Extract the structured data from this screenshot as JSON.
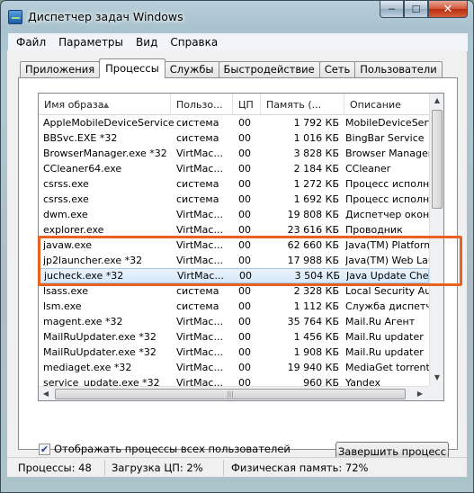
{
  "window": {
    "title": "Диспетчер задач Windows"
  },
  "menu": [
    "Файл",
    "Параметры",
    "Вид",
    "Справка"
  ],
  "tabs": [
    "Приложения",
    "Процессы",
    "Службы",
    "Быстродействие",
    "Сеть",
    "Пользователи"
  ],
  "active_tab": "Процессы",
  "columns": [
    "Имя образа",
    "Пользо...",
    "ЦП",
    "Память (...",
    "Описание"
  ],
  "processes": [
    {
      "name": "AppleMobileDeviceService....",
      "user": "система",
      "cpu": "00",
      "mem": "1 792 КБ",
      "desc": "MobileDeviceService"
    },
    {
      "name": "BBSvc.EXE *32",
      "user": "система",
      "cpu": "00",
      "mem": "1 016 КБ",
      "desc": "BingBar Service"
    },
    {
      "name": "BrowserManager.exe *32",
      "user": "VirtMac...",
      "cpu": "00",
      "mem": "3 828 КБ",
      "desc": "Browser Manager"
    },
    {
      "name": "CCleaner64.exe",
      "user": "VirtMac...",
      "cpu": "00",
      "mem": "2 184 КБ",
      "desc": "CCleaner"
    },
    {
      "name": "csrss.exe",
      "user": "система",
      "cpu": "00",
      "mem": "1 272 КБ",
      "desc": "Процесс исполнения"
    },
    {
      "name": "csrss.exe",
      "user": "система",
      "cpu": "00",
      "mem": "1 692 КБ",
      "desc": "Процесс исполнения"
    },
    {
      "name": "dwm.exe",
      "user": "VirtMac...",
      "cpu": "00",
      "mem": "19 808 КБ",
      "desc": "Диспетчер окон рабо"
    },
    {
      "name": "explorer.exe",
      "user": "VirtMac...",
      "cpu": "00",
      "mem": "23 616 КБ",
      "desc": "Проводник"
    },
    {
      "name": "javaw.exe",
      "user": "VirtMac...",
      "cpu": "00",
      "mem": "62 660 КБ",
      "desc": "Java(TM) Platform SE"
    },
    {
      "name": "jp2launcher.exe *32",
      "user": "VirtMac...",
      "cpu": "00",
      "mem": "17 988 КБ",
      "desc": "Java(TM) Web Launch"
    },
    {
      "name": "jucheck.exe *32",
      "user": "VirtMac...",
      "cpu": "00",
      "mem": "3 504 КБ",
      "desc": "Java Update Checker"
    },
    {
      "name": "lsass.exe",
      "user": "система",
      "cpu": "00",
      "mem": "2 328 КБ",
      "desc": "Local Security Authori"
    },
    {
      "name": "lsm.exe",
      "user": "система",
      "cpu": "00",
      "mem": "1 112 КБ",
      "desc": "Служба диспетчера"
    },
    {
      "name": "magent.exe *32",
      "user": "VirtMac...",
      "cpu": "00",
      "mem": "35 764 КБ",
      "desc": "Mail.Ru Агент"
    },
    {
      "name": "MailRuUpdater.exe *32",
      "user": "VirtMac...",
      "cpu": "00",
      "mem": "1 456 КБ",
      "desc": "Mail.Ru updater"
    },
    {
      "name": "MailRuUpdater.exe *32",
      "user": "VirtMac...",
      "cpu": "00",
      "mem": "1 908 КБ",
      "desc": "Mail.Ru updater"
    },
    {
      "name": "mediaget.exe *32",
      "user": "VirtMac...",
      "cpu": "00",
      "mem": "19 940 КБ",
      "desc": "MediaGet torrent clien"
    },
    {
      "name": "service_update.exe *32",
      "user": "VirtMac...",
      "cpu": "00",
      "mem": "960 КБ",
      "desc": "Yandex"
    }
  ],
  "selected_process": "jucheck.exe *32",
  "show_all_label": "Отображать процессы всех пользователей",
  "show_all_checked": true,
  "end_process_label": "Завершить процесс",
  "status": {
    "processes": "Процессы: 48",
    "cpu": "Загрузка ЦП: 2%",
    "memory": "Физическая память: 72%"
  },
  "colors": {
    "highlight": "#e8611e",
    "selection": "#d6e8fa"
  },
  "icons": {
    "window_min": "minimize-icon",
    "window_max": "maximize-icon",
    "window_close": "close-icon",
    "sort": "sort-up-icon"
  }
}
